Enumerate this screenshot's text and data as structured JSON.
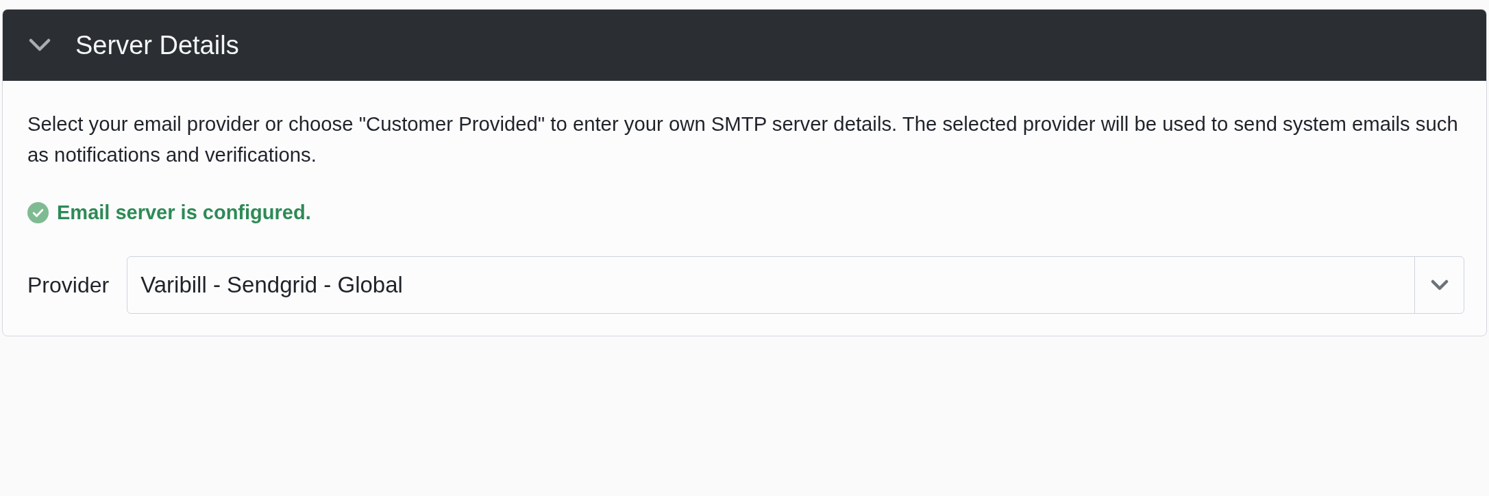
{
  "panel": {
    "title": "Server Details",
    "expanded": true,
    "description": "Select your email provider or choose \"Customer Provided\" to enter your own SMTP server details. The selected provider will be used to send system emails such as notifications and verifications.",
    "status": {
      "kind": "success",
      "text": "Email server is configured."
    },
    "fields": [
      {
        "kind": "select",
        "label": "Provider",
        "value": "Varibill - Sendgrid - Global"
      }
    ]
  }
}
